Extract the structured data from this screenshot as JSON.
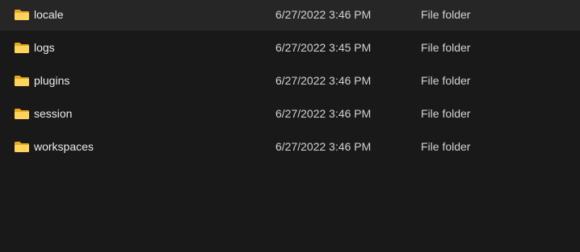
{
  "files": [
    {
      "name": "locale",
      "date_modified": "6/27/2022 3:46 PM",
      "type": "File folder",
      "icon": "folder-icon"
    },
    {
      "name": "logs",
      "date_modified": "6/27/2022 3:45 PM",
      "type": "File folder",
      "icon": "folder-icon"
    },
    {
      "name": "plugins",
      "date_modified": "6/27/2022 3:46 PM",
      "type": "File folder",
      "icon": "folder-icon"
    },
    {
      "name": "session",
      "date_modified": "6/27/2022 3:46 PM",
      "type": "File folder",
      "icon": "folder-icon"
    },
    {
      "name": "workspaces",
      "date_modified": "6/27/2022 3:46 PM",
      "type": "File folder",
      "icon": "folder-icon"
    }
  ],
  "colors": {
    "background": "#191919",
    "folder_front": "#FFD35B",
    "folder_back": "#E8A91C",
    "text_primary": "#eaeaea",
    "text_secondary": "#d2d2d2"
  }
}
